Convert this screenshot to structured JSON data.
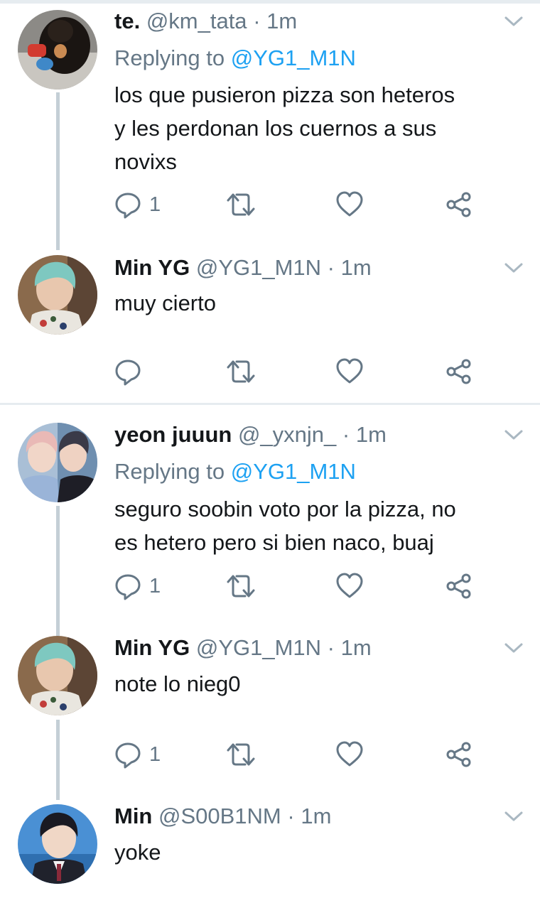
{
  "tweets": [
    {
      "name": "te.",
      "handle": "@km_tata",
      "time": "· 1m",
      "reply_prefix": "Replying to",
      "reply_to": "@YG1_M1N",
      "text": "los que pusieron pizza son heteros\ny les perdonan los cuernos a sus\nnovixs",
      "reply_count": "1"
    },
    {
      "name": "Min YG",
      "handle": "@YG1_M1N",
      "time": "· 1m",
      "text": "muy cierto",
      "reply_count": ""
    },
    {
      "name": "yeon juuun",
      "handle": "@_yxnjn_",
      "time": "· 1m",
      "reply_prefix": "Replying to",
      "reply_to": "@YG1_M1N",
      "text": "seguro soobin voto por la pizza, no\nes hetero pero si bien naco, buaj",
      "reply_count": "1"
    },
    {
      "name": "Min YG",
      "handle": "@YG1_M1N",
      "time": "· 1m",
      "text": "note lo nieg0",
      "reply_count": "1"
    },
    {
      "name": "Min",
      "handle": "@S00B1NM",
      "time": "· 1m",
      "text": "yoke"
    }
  ],
  "colors": {
    "text": "#14171a",
    "secondary": "#657786",
    "link": "#1da1f2",
    "thread_line": "#c4cfd6",
    "divider": "#e6ecf0"
  },
  "icons": {
    "reply": "reply-icon",
    "retweet": "retweet-icon",
    "like": "heart-icon",
    "share": "share-icon",
    "menu": "chevron-down-icon"
  }
}
